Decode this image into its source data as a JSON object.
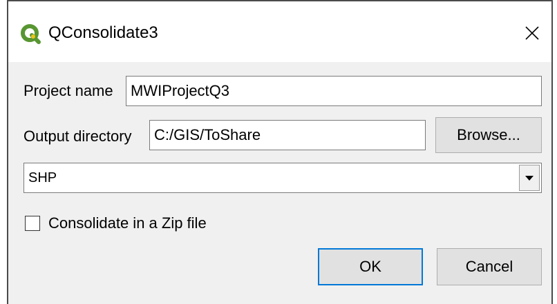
{
  "window": {
    "title": "QConsolidate3",
    "app_icon": "qgis-logo-icon",
    "close_icon": "close-icon"
  },
  "form": {
    "project_name_label": "Project name",
    "project_name_value": "MWIProjectQ3",
    "output_directory_label": "Output directory",
    "output_directory_value": "C:/GIS/ToShare",
    "browse_label": "Browse...",
    "format_selected": "SHP",
    "zip_checkbox_label": "Consolidate in a Zip file",
    "zip_checked": false
  },
  "buttons": {
    "ok_label": "OK",
    "cancel_label": "Cancel"
  },
  "colors": {
    "accent": "#0078d7",
    "qgis_green": "#589632",
    "qgis_yellow": "#ee7913",
    "dialog_bg": "#f0f0f0"
  }
}
